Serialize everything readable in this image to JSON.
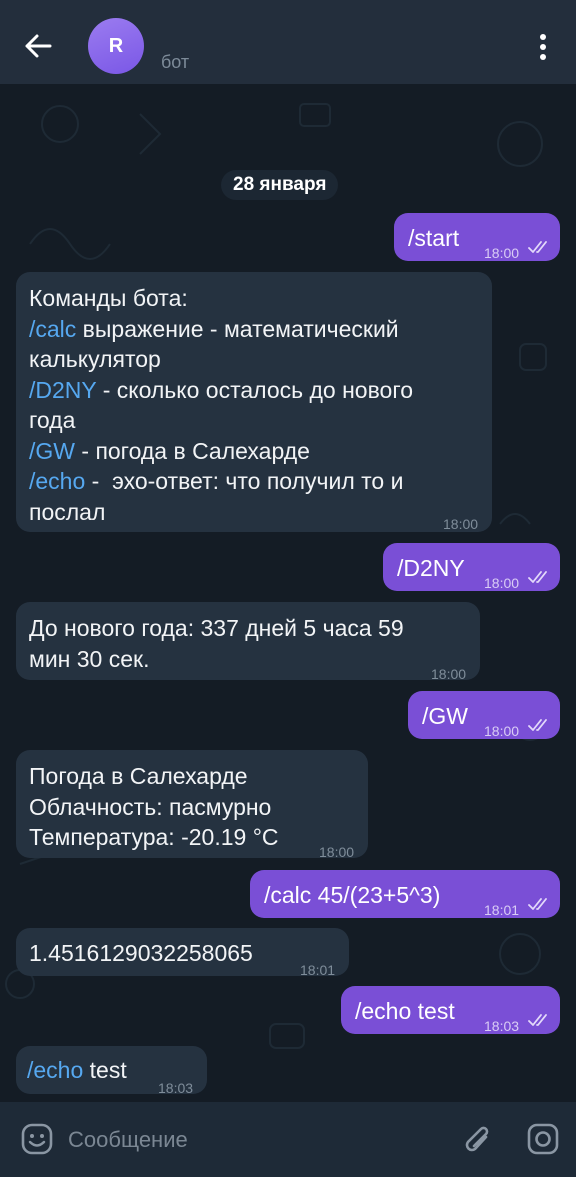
{
  "header": {
    "avatar_letter": "R",
    "subtitle": "бот",
    "back_icon": "arrow-left-icon",
    "menu_icon": "more-vertical-icon"
  },
  "chat": {
    "date": "28 января",
    "messages": [
      {
        "dir": "out",
        "text": "/start",
        "time": "18:00",
        "read": true
      },
      {
        "dir": "in",
        "lines": [
          {
            "cmd": "",
            "text": "Команды бота:"
          },
          {
            "cmd": "/calc",
            "text": " выражение - математический"
          },
          {
            "cmd": "",
            "text": "калькулятор"
          },
          {
            "cmd": "/D2NY",
            "text": " - сколько осталось до нового"
          },
          {
            "cmd": "",
            "text": "года"
          },
          {
            "cmd": "/GW",
            "text": " - погода в Салехарде"
          },
          {
            "cmd": "/echo",
            "text": " -  эхо-ответ: что получил то и"
          },
          {
            "cmd": "",
            "text": "послал"
          }
        ],
        "time": "18:00"
      },
      {
        "dir": "out",
        "text": "/D2NY",
        "time": "18:00",
        "read": true
      },
      {
        "dir": "in",
        "lines": [
          {
            "cmd": "",
            "text": "До нового года: 337 дней 5 часа 59"
          },
          {
            "cmd": "",
            "text": "мин 30 сек."
          }
        ],
        "time": "18:00"
      },
      {
        "dir": "out",
        "text": "/GW",
        "time": "18:00",
        "read": true
      },
      {
        "dir": "in",
        "lines": [
          {
            "cmd": "",
            "text": "Погода в Салехарде"
          },
          {
            "cmd": "",
            "text": "Облачность: пасмурно"
          },
          {
            "cmd": "",
            "text": "Температура: -20.19 °С"
          }
        ],
        "time": "18:00"
      },
      {
        "dir": "out",
        "text": "/calc 45/(23+5^3)",
        "time": "18:01",
        "read": true
      },
      {
        "dir": "in",
        "lines": [
          {
            "cmd": "",
            "text": "1.4516129032258065"
          }
        ],
        "time": "18:01"
      },
      {
        "dir": "out",
        "text": "/echo test",
        "time": "18:03",
        "read": true
      },
      {
        "dir": "in",
        "lines": [
          {
            "cmd": "/echo",
            "text": " test"
          }
        ],
        "time": "18:03"
      }
    ]
  },
  "composer": {
    "placeholder": "Сообщение",
    "emoji_icon": "emoji-icon",
    "attach_icon": "paperclip-icon",
    "camera_icon": "camera-icon"
  },
  "colors": {
    "header_bg": "#232e3c",
    "incoming_bubble": "#253240",
    "outgoing_bubble": "#7a4fd6",
    "command_link": "#56a8f0",
    "avatar": "#8a68ea"
  }
}
